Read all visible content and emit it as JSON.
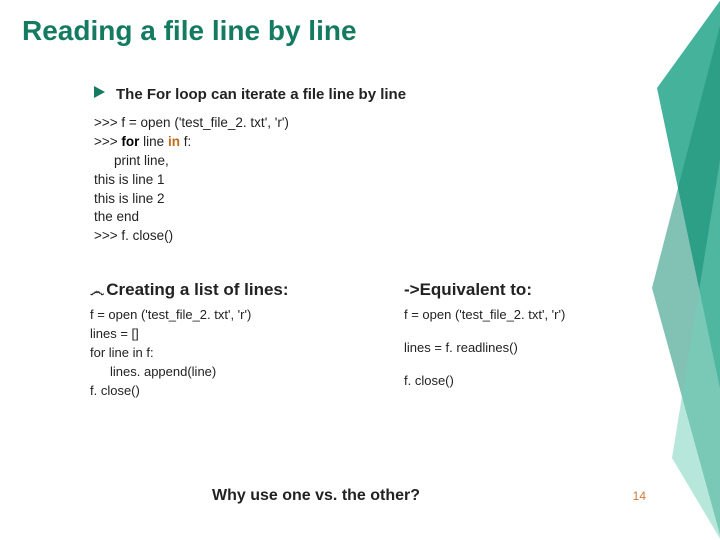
{
  "title": "Reading a file line by line",
  "section1": {
    "bullet": "The For loop can iterate a file line by line",
    "code": {
      "l1_pre": ">>> f = open ('test_file_2. txt', 'r')",
      "l2_prompt": ">>> ",
      "l2_for": "for",
      "l2_mid": " line ",
      "l2_in": "in",
      "l2_post": " f:",
      "l3": "print line,",
      "l4": "this is line 1",
      "l5": "this is line 2",
      "l6": "the end",
      "l7": ">>>  f. close()"
    }
  },
  "columns": {
    "left": {
      "heading": "Creating a list of lines:",
      "l1": "f = open ('test_file_2. txt', 'r')",
      "l2": "lines = []",
      "l3": "for line in f:",
      "l4": "lines. append(line)",
      "l5": "f. close()"
    },
    "right": {
      "heading": "->Equivalent to:",
      "l1": "f = open ('test_file_2. txt', 'r')",
      "l2": "lines = f. readlines()",
      "l3": "f. close()"
    }
  },
  "question": "Why use one vs. the other?",
  "pagenum": "14"
}
